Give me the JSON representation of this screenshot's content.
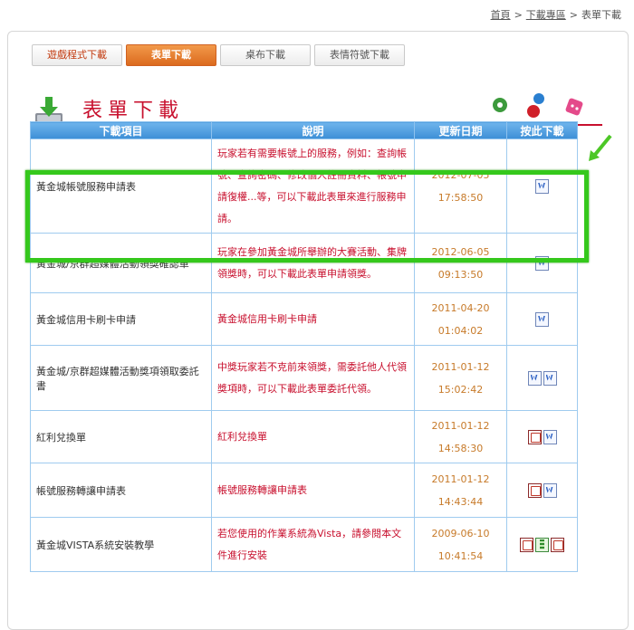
{
  "breadcrumb": {
    "home": "首頁",
    "sep1": ">",
    "section": "下載專區",
    "sep2": ">",
    "current": "表單下載"
  },
  "tabs": [
    {
      "label": "遊戲程式下載"
    },
    {
      "label": "表單下載",
      "active": true
    },
    {
      "label": "桌布下載"
    },
    {
      "label": "表情符號下載"
    }
  ],
  "page": {
    "title": "表單下載",
    "icon": "download-tray-icon"
  },
  "table": {
    "headers": [
      "下載項目",
      "說明",
      "更新日期",
      "按此下載"
    ],
    "rows": [
      {
        "name": "黃金城帳號服務申請表",
        "desc": "玩家若有需要帳號上的服務，例如：查詢帳號、查詢密碼、修改個人註冊資料、帳號申請復權...等，可以下載此表單來進行服務申請。",
        "date": "2012-07-05",
        "time": "17:58:50",
        "icons": [
          "word"
        ]
      },
      {
        "name": "黃金城/京群超媒體活動領獎確認單",
        "desc": "玩家在參加黃金城所舉辦的大賽活動、集牌領獎時，可以下載此表單申請領獎。",
        "date": "2012-06-05",
        "time": "09:13:50",
        "icons": [
          "word"
        ]
      },
      {
        "name": "黃金城信用卡刷卡申請",
        "desc": "黃金城信用卡刷卡申請",
        "date": "2011-04-20",
        "time": "01:04:02",
        "icons": [
          "word"
        ]
      },
      {
        "name": "黃金城/京群超媒體活動獎項領取委託書",
        "desc": "中獎玩家若不克前來領獎，需委託他人代領獎項時，可以下載此表單委託代領。",
        "date": "2011-01-12",
        "time": "15:02:42",
        "icons": [
          "word",
          "word"
        ]
      },
      {
        "name": "紅利兌換單",
        "desc": "紅利兌換單",
        "date": "2011-01-12",
        "time": "14:58:30",
        "icons": [
          "pdf",
          "word"
        ]
      },
      {
        "name": "帳號服務轉讓申請表",
        "desc": "帳號服務轉讓申請表",
        "date": "2011-01-12",
        "time": "14:43:44",
        "icons": [
          "pdf",
          "word"
        ]
      },
      {
        "name": "黃金城VISTA系統安裝教學",
        "desc": "若您使用的作業系統為Vista，請參閱本文件進行安裝",
        "date": "2009-06-10",
        "time": "10:41:54",
        "icons": [
          "pdf",
          "zip",
          "pdf"
        ]
      }
    ]
  },
  "colors": {
    "accent_red": "#c8102e",
    "active_tab": "#e87a2c",
    "header_blue": "#4a9ae0",
    "highlight_green": "#35c81c",
    "date_orange": "#c77a29"
  }
}
